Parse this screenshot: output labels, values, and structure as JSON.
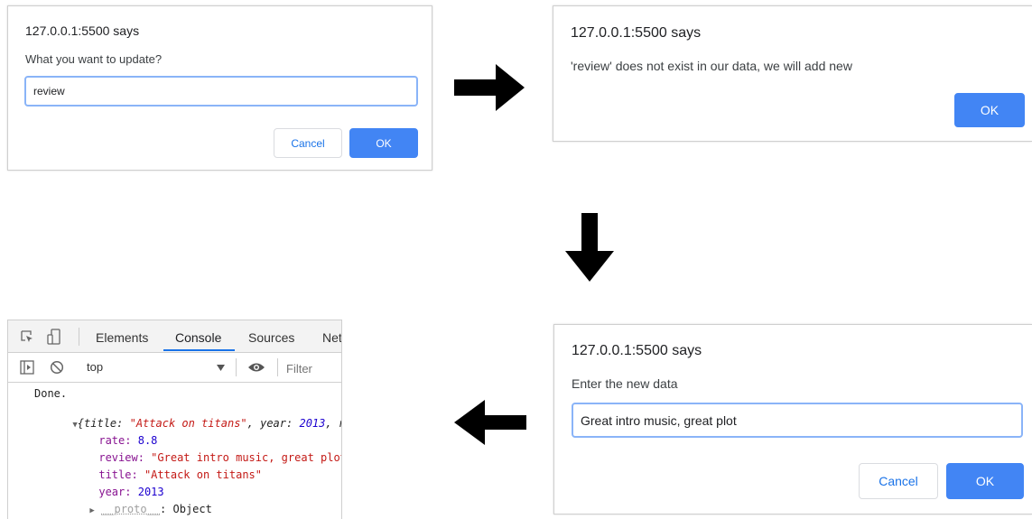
{
  "dialog_update": {
    "title": "127.0.0.1:5500 says",
    "message": "What you want to update?",
    "input_value": "review",
    "cancel_label": "Cancel",
    "ok_label": "OK"
  },
  "dialog_notice": {
    "title": "127.0.0.1:5500 says",
    "message": "'review' does not exist in our data, we will add new",
    "ok_label": "OK"
  },
  "dialog_new_data": {
    "title": "127.0.0.1:5500 says",
    "message": "Enter the new data",
    "input_value": "Great intro music, great plot",
    "cancel_label": "Cancel",
    "ok_label": "OK"
  },
  "devtools": {
    "tabs": [
      "Elements",
      "Console",
      "Sources",
      "Net"
    ],
    "active_tab": "Console",
    "context": "top",
    "filter_placeholder": "Filter",
    "console": {
      "done": "Done.",
      "object_summary": {
        "open": "{",
        "title_key": "title:",
        "title_val": "\"Attack on titans\"",
        "sep1": ", ",
        "year_key": "year:",
        "year_val": "2013",
        "sep2": ", r"
      },
      "props": [
        {
          "key": "rate:",
          "value": "8.8",
          "kind": "num"
        },
        {
          "key": "review:",
          "value": "\"Great intro music, great plot\"",
          "kind": "str"
        },
        {
          "key": "title:",
          "value": "\"Attack on titans\"",
          "kind": "str"
        },
        {
          "key": "year:",
          "value": "2013",
          "kind": "num"
        }
      ],
      "proto_key": "__proto__",
      "proto_val": ": Object"
    }
  },
  "icons": [
    "inspect-icon",
    "device-toggle-icon",
    "sidebar-toggle-icon",
    "clear-console-icon",
    "eye-icon",
    "dropdown-caret-icon",
    "arrow-right-icon",
    "arrow-down-icon",
    "arrow-left-icon"
  ],
  "colors": {
    "accent": "#4285f4",
    "cancel_text": "#1a73e8",
    "input_border": "#8ab4f8"
  }
}
